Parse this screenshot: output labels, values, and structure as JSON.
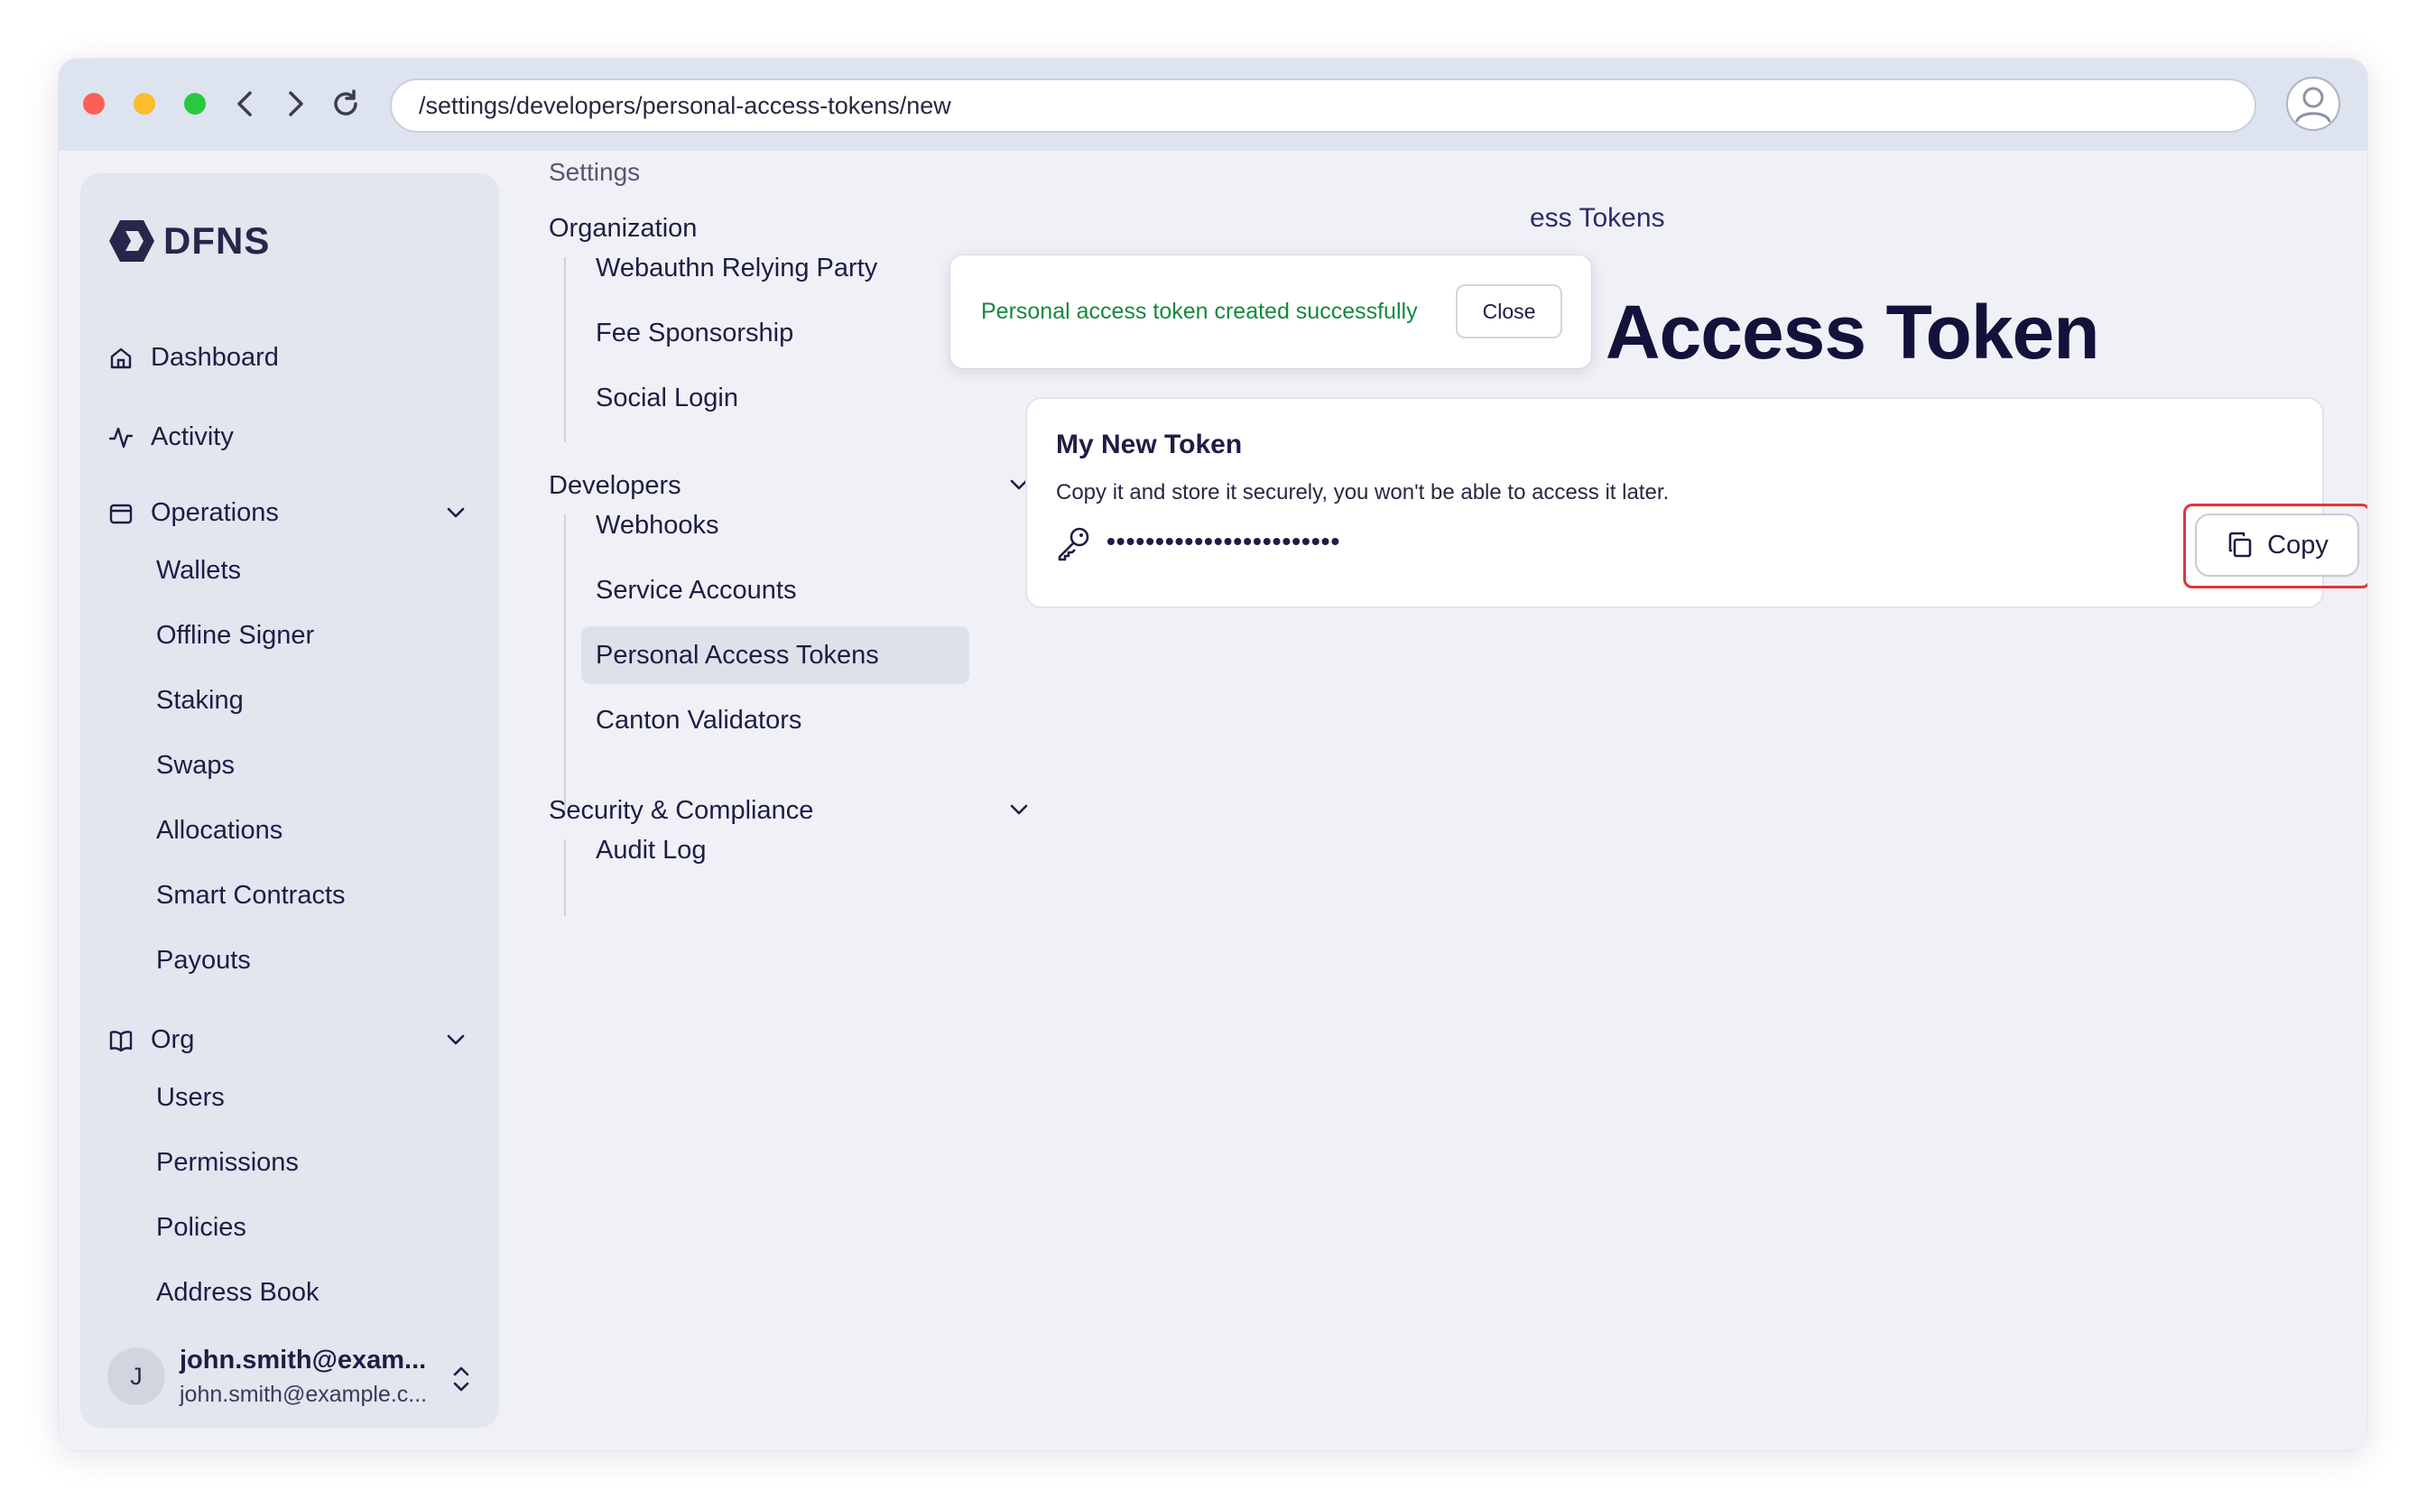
{
  "browser": {
    "url": "/settings/developers/personal-access-tokens/new"
  },
  "sidebar": {
    "logo": "DFNS",
    "dashboard": "Dashboard",
    "activity": "Activity",
    "operations": {
      "label": "Operations",
      "items": [
        "Wallets",
        "Offline Signer",
        "Staking",
        "Swaps",
        "Allocations",
        "Smart Contracts",
        "Payouts"
      ]
    },
    "org": {
      "label": "Org",
      "items": [
        "Users",
        "Permissions",
        "Policies",
        "Address Book"
      ]
    },
    "user": {
      "initial": "J",
      "name": "john.smith@exam...",
      "email": "john.smith@example.c..."
    }
  },
  "settings": {
    "title": "Settings",
    "organization": {
      "label": "Organization",
      "items": [
        "Webauthn Relying Party",
        "Fee Sponsorship",
        "Social Login"
      ]
    },
    "developers": {
      "label": "Developers",
      "items": [
        "Webhooks",
        "Service Accounts",
        "Personal Access Tokens",
        "Canton Validators"
      ]
    },
    "security": {
      "label": "Security & Compliance",
      "items": [
        "Audit Log"
      ]
    }
  },
  "main": {
    "breadcrumb": "ess Tokens",
    "title": "Create Personal Access Token",
    "card": {
      "token_name": "My New Token",
      "description": "Copy it and store it securely, you won't be able to access it later.",
      "token_masked": "••••••••••••••••••••••••",
      "copy_label": "Copy"
    }
  },
  "toast": {
    "message": "Personal access token created successfully",
    "close_label": "Close"
  },
  "colors": {
    "success": "#15883f",
    "highlight": "#e0353a"
  }
}
